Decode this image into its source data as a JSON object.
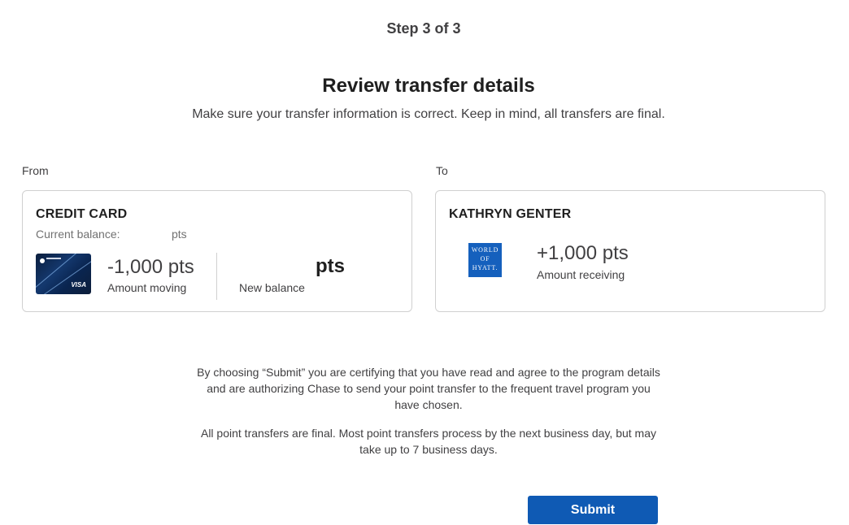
{
  "header": {
    "step": "Step 3 of 3",
    "title": "Review transfer details",
    "subtitle": "Make sure your transfer information is correct. Keep in mind, all transfers are final."
  },
  "from": {
    "section_label": "From",
    "heading": "CREDIT CARD",
    "current_balance_label": "Current balance:",
    "current_balance_value": "",
    "current_balance_unit": "pts",
    "card_image": "credit-card-image",
    "amount_moving": "-1,000 pts",
    "amount_moving_label": "Amount moving",
    "new_balance_value": "",
    "new_balance_unit": "pts",
    "new_balance_label": "New balance"
  },
  "to": {
    "section_label": "To",
    "heading": "KATHRYN GENTER",
    "logo": {
      "name": "world-of-hyatt-logo",
      "lines": [
        "WORLD",
        "OF",
        "HYATT."
      ],
      "color": "#1560bd"
    },
    "amount_receiving": "+1,000 pts",
    "amount_receiving_label": "Amount receiving"
  },
  "disclaimer": {
    "certify": "By choosing “Submit” you are certifying that you have read and agree to the program details and are authorizing Chase to send your point transfer to the frequent travel program you have chosen.",
    "final": "All point transfers are final. Most point transfers process by the next business day, but may take up to 7 business days."
  },
  "actions": {
    "submit_label": "Submit",
    "submit_color": "#0f5ab4"
  }
}
